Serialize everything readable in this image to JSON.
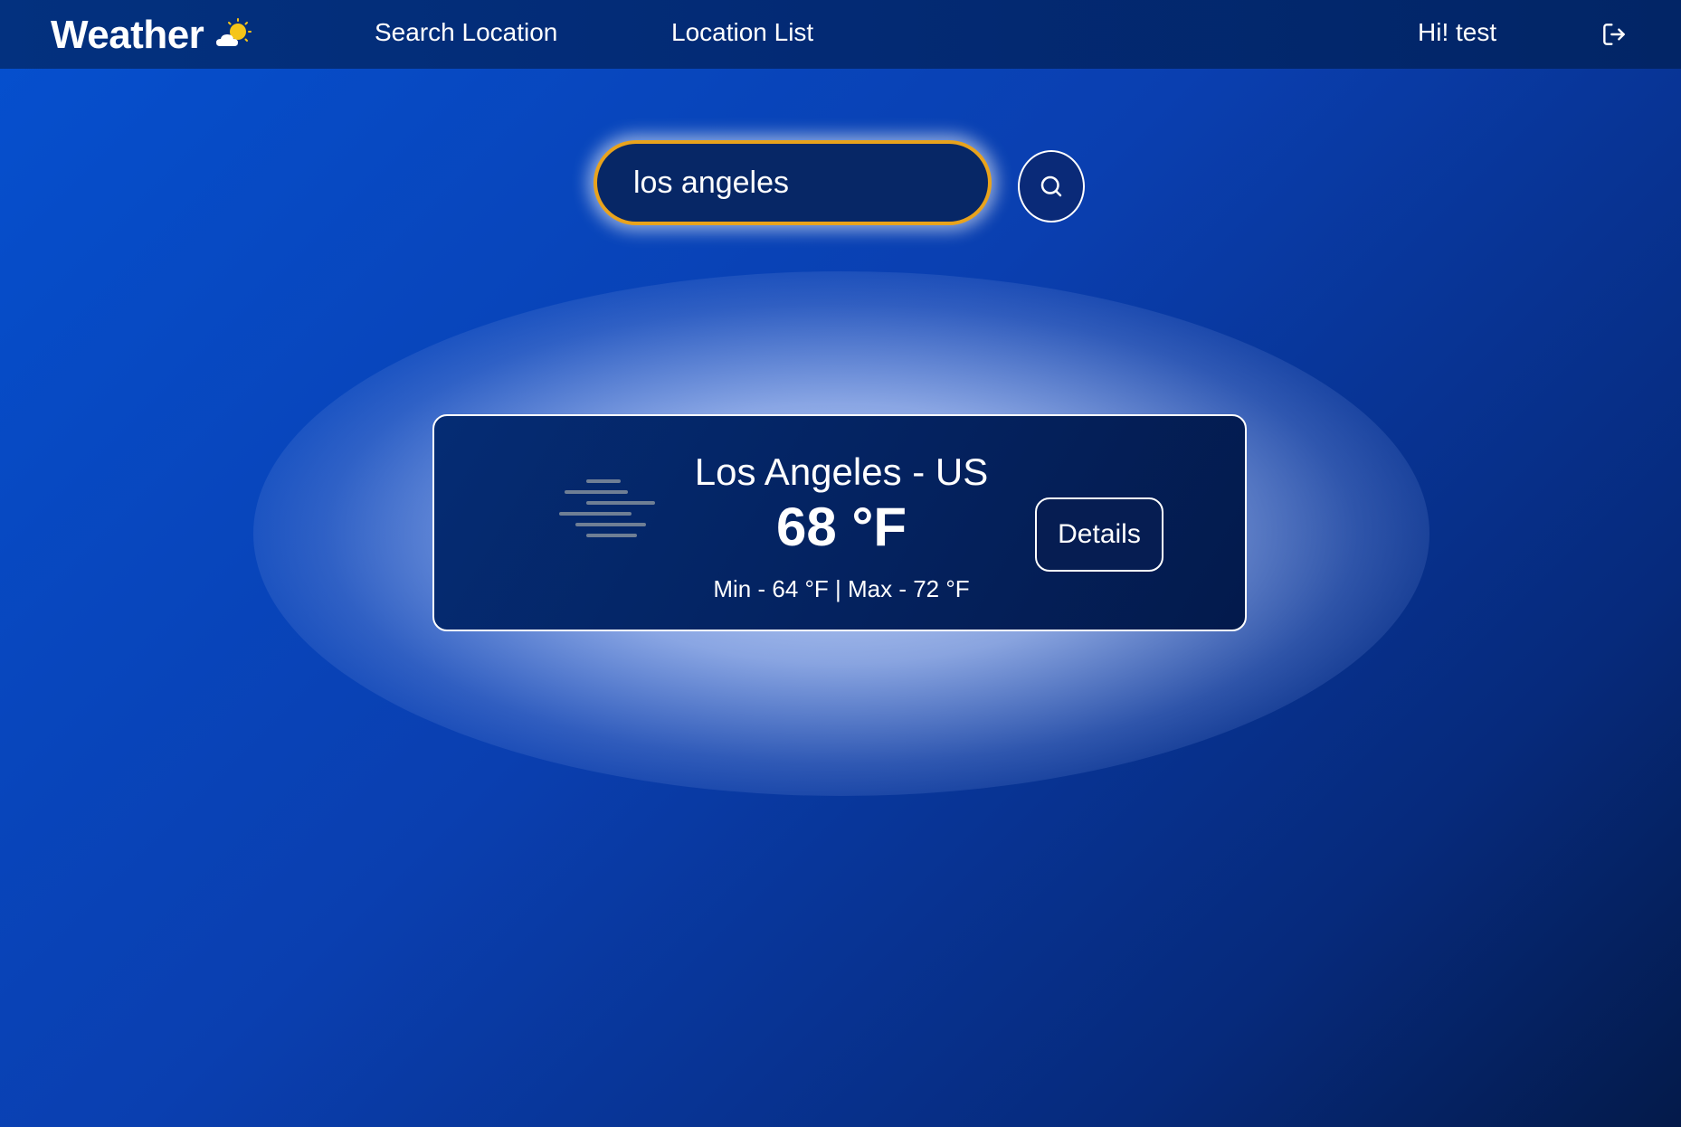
{
  "navbar": {
    "brand": "Weather",
    "brand_icon": "partly-sunny-icon",
    "links": [
      "Search Location",
      "Location List"
    ],
    "greeting": "Hi! test",
    "logout_icon": "logout-icon"
  },
  "search": {
    "value": "los angeles",
    "button_icon": "search-icon",
    "accent_color": "#e9a31c"
  },
  "result": {
    "location": "Los Angeles - US",
    "temperature": "68 °F",
    "minmax": "Min - 64 °F | Max - 72 °F",
    "details_label": "Details",
    "condition_icon": "mist-icon"
  },
  "colors": {
    "background": "#0a3fb0",
    "navbar": "#032a74",
    "card": "#04225f"
  }
}
